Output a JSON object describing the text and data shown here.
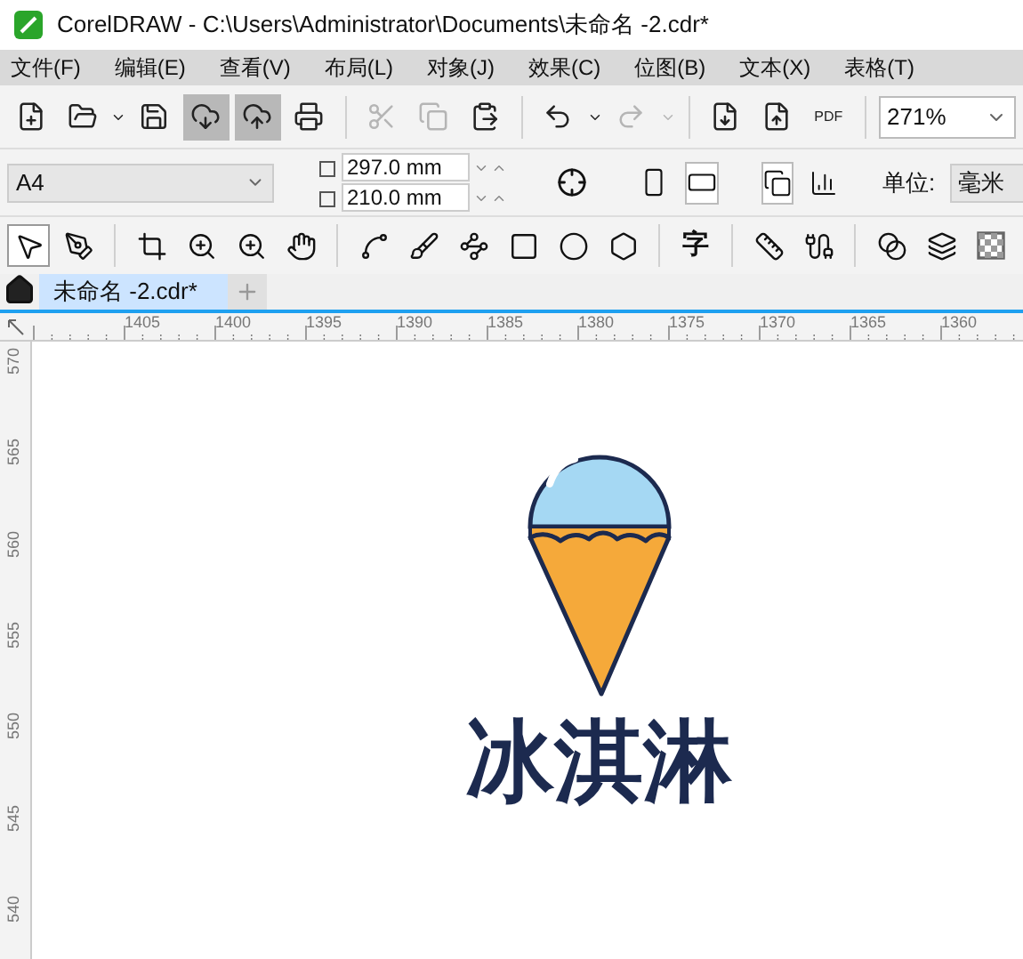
{
  "window": {
    "title": "CorelDRAW - C:\\Users\\Administrator\\Documents\\未命名 -2.cdr*"
  },
  "menu": [
    "文件(F)",
    "编辑(E)",
    "查看(V)",
    "布局(L)",
    "对象(J)",
    "效果(C)",
    "位图(B)",
    "文本(X)",
    "表格(T)"
  ],
  "toolbar": [
    {
      "kind": "new",
      "highlighted": false,
      "disabled": false
    },
    {
      "kind": "open",
      "highlighted": false,
      "disabled": false
    },
    {
      "kind": "save",
      "highlighted": false,
      "disabled": false
    },
    {
      "kind": "cloud-down",
      "highlighted": true,
      "disabled": false
    },
    {
      "kind": "cloud-up",
      "highlighted": true,
      "disabled": false
    },
    {
      "kind": "print",
      "highlighted": false,
      "disabled": false
    },
    {
      "kind": "cut",
      "highlighted": false,
      "disabled": true
    },
    {
      "kind": "copy",
      "highlighted": false,
      "disabled": true
    },
    {
      "kind": "paste",
      "highlighted": false,
      "disabled": false
    },
    {
      "kind": "undo",
      "highlighted": false,
      "disabled": false
    },
    {
      "kind": "redo",
      "highlighted": false,
      "disabled": true
    },
    {
      "kind": "import",
      "highlighted": false,
      "disabled": false
    },
    {
      "kind": "export",
      "highlighted": false,
      "disabled": false
    },
    {
      "kind": "pdf",
      "label": "PDF",
      "highlighted": false,
      "disabled": false
    }
  ],
  "zoom": {
    "value": "271%"
  },
  "property_bar": {
    "page_size": "A4",
    "width": "297.0 mm",
    "height": "210.0 mm",
    "orientations": [
      {
        "kind": "portrait",
        "selected": false
      },
      {
        "kind": "landscape",
        "selected": true
      }
    ],
    "page_options": [
      {
        "kind": "all-pages",
        "selected": true
      },
      {
        "kind": "current-page",
        "selected": false
      }
    ],
    "unit_label": "单位:",
    "unit": "毫米"
  },
  "toolbox": [
    {
      "kind": "pick",
      "selected": true
    },
    {
      "kind": "shape",
      "selected": false
    },
    {
      "kind": "crop",
      "selected": false
    },
    {
      "kind": "zoom",
      "selected": false
    },
    {
      "kind": "zoom",
      "selected": false
    },
    {
      "kind": "pan",
      "selected": false
    },
    {
      "kind": "curve",
      "selected": false
    },
    {
      "kind": "brush",
      "selected": false
    },
    {
      "kind": "smart",
      "selected": false
    },
    {
      "kind": "rect",
      "selected": false
    },
    {
      "kind": "ellipse",
      "selected": false
    },
    {
      "kind": "polygon",
      "selected": false
    },
    {
      "kind": "text",
      "label": "字",
      "selected": false
    },
    {
      "kind": "dimension",
      "selected": false
    },
    {
      "kind": "connector",
      "selected": false
    },
    {
      "kind": "blend",
      "selected": false
    },
    {
      "kind": "shadow",
      "selected": false
    },
    {
      "kind": "transparency",
      "selected": false
    }
  ],
  "tabs": [
    {
      "label": "未命名 -2.cdr*",
      "selected": true
    }
  ],
  "rulers": {
    "horizontal": [
      "1405",
      "1400",
      "1395",
      "1390",
      "1385",
      "1380",
      "1375",
      "1370",
      "1365",
      "1360"
    ],
    "vertical": [
      "570",
      "565",
      "560",
      "555",
      "550",
      "545",
      "540"
    ]
  },
  "artwork": {
    "text": "冰淇淋"
  }
}
